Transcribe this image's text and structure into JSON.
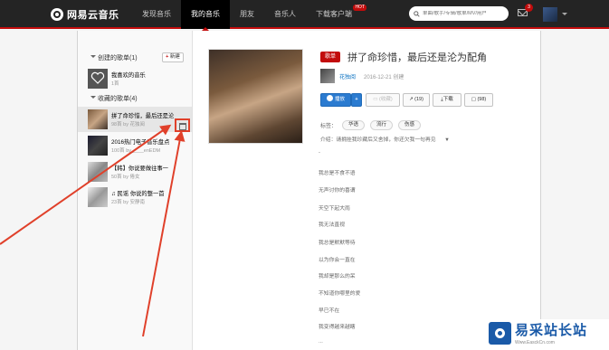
{
  "brand": {
    "name": "网易云音乐"
  },
  "nav": {
    "items": [
      "发现音乐",
      "我的音乐",
      "朋友",
      "音乐人",
      "下载客户端"
    ],
    "active_index": 1,
    "hot_badge": "HOT"
  },
  "search": {
    "placeholder": "单曲/歌手/专辑/歌单/MV/用户"
  },
  "messages": {
    "count": "3"
  },
  "sidebar": {
    "created_header": "创建的歌单(1)",
    "new_button": "新建",
    "created": [
      {
        "name": "我喜欢的音乐",
        "meta": "1首"
      }
    ],
    "collected_header": "收藏的歌单(4)",
    "collected": [
      {
        "name": "拼了命珍惜，最后还是沦",
        "meta": "98首 by 花独阅"
      },
      {
        "name": "2016热门电子音乐盘点",
        "meta": "100首 by ____enEDM"
      },
      {
        "name": "【韩】你说要做往事一",
        "meta": "50首 by 倦女"
      },
      {
        "name": "♫ 民谣 你说的整一首",
        "meta": "23首 by 安静南"
      }
    ]
  },
  "playlist": {
    "tag": "歌单",
    "title": "拼了命珍惜，最后还是沦为配角",
    "creator": "花独阅",
    "created": "2016-12-21 创建",
    "buttons": {
      "play": "播放",
      "add": "+",
      "collect": "(收藏)",
      "share": "(19)",
      "download": "下载",
      "comment": "(98)"
    },
    "tags_label": "标签：",
    "tags": [
      "华语",
      "流行",
      "伤感"
    ],
    "intro": "介绍：请拥挂我珍藏后又舍掉，你还欠我一句再见",
    "lyrics": [
      "-",
      "我总是不食不语",
      "无声讨你的喜谓",
      "天空下起大雨",
      "我无法直视",
      "我总是默默等待",
      "以为你会一直在",
      "我却是那么的呆",
      "不知道你哪里的爱",
      "早已不在",
      "我变得越来越瞎",
      "..."
    ]
  },
  "watermark": {
    "text": "易采站长站",
    "url": "Www.EasckCn.com"
  },
  "colors": {
    "brand_red": "#c20c0c",
    "nav_bg": "#242424",
    "link_blue": "#0c73c2",
    "annotation_red": "#e0402a"
  }
}
